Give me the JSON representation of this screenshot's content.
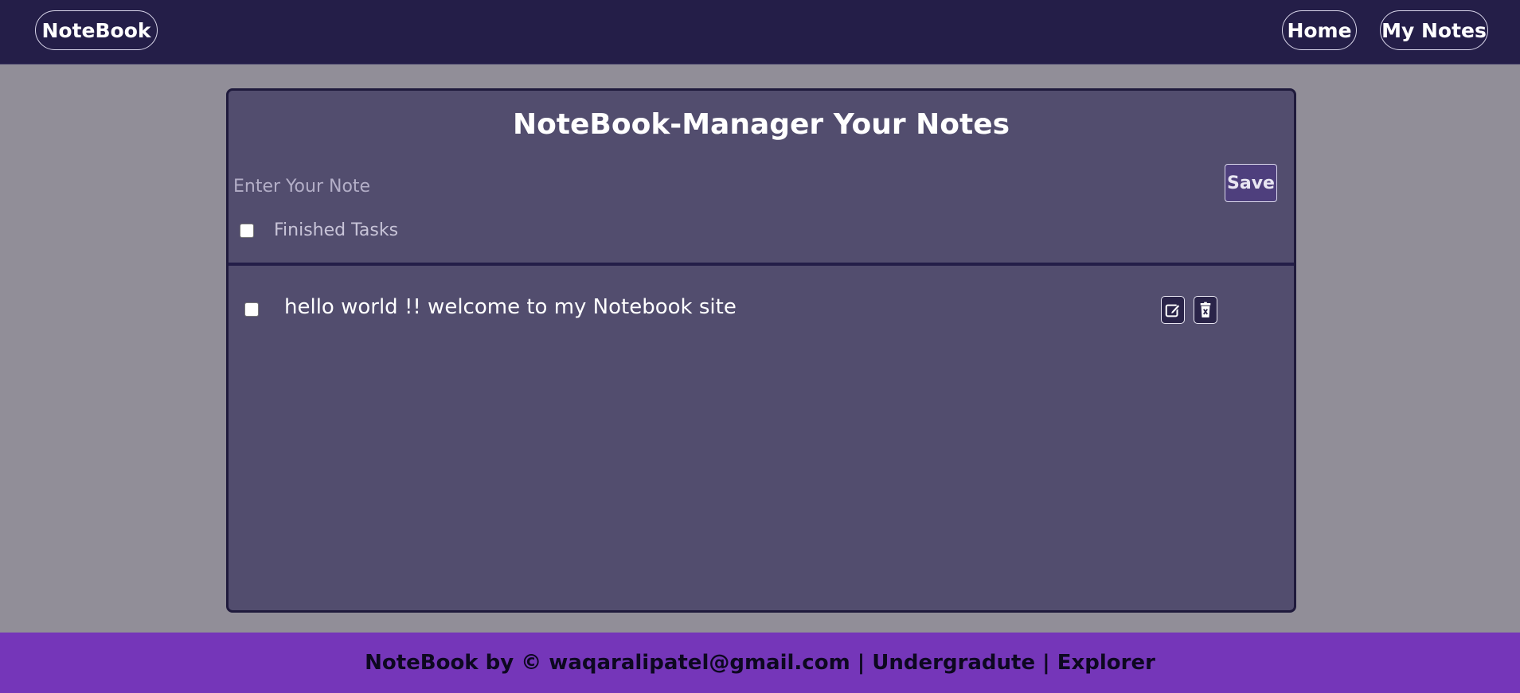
{
  "navbar": {
    "brand": "NoteBook",
    "links": [
      {
        "label": "Home"
      },
      {
        "label": "My Notes"
      }
    ]
  },
  "card": {
    "title": "NoteBook-Manager Your Notes",
    "input": {
      "placeholder": "Enter Your Note",
      "value": ""
    },
    "save_label": "Save",
    "finished_label": "Finished Tasks",
    "finished_checked": false
  },
  "notes": [
    {
      "text": "hello world !! welcome to my Notebook site",
      "checked": false,
      "edit_icon": "edit-icon",
      "delete_icon": "trash-icon"
    }
  ],
  "footer": {
    "text": "NoteBook by © waqaralipatel@gmail.com | Undergradute | Explorer"
  },
  "colors": {
    "navbar": "#241e48",
    "background": "#918e98",
    "card": "#524d6e",
    "footer": "#7536b9"
  }
}
